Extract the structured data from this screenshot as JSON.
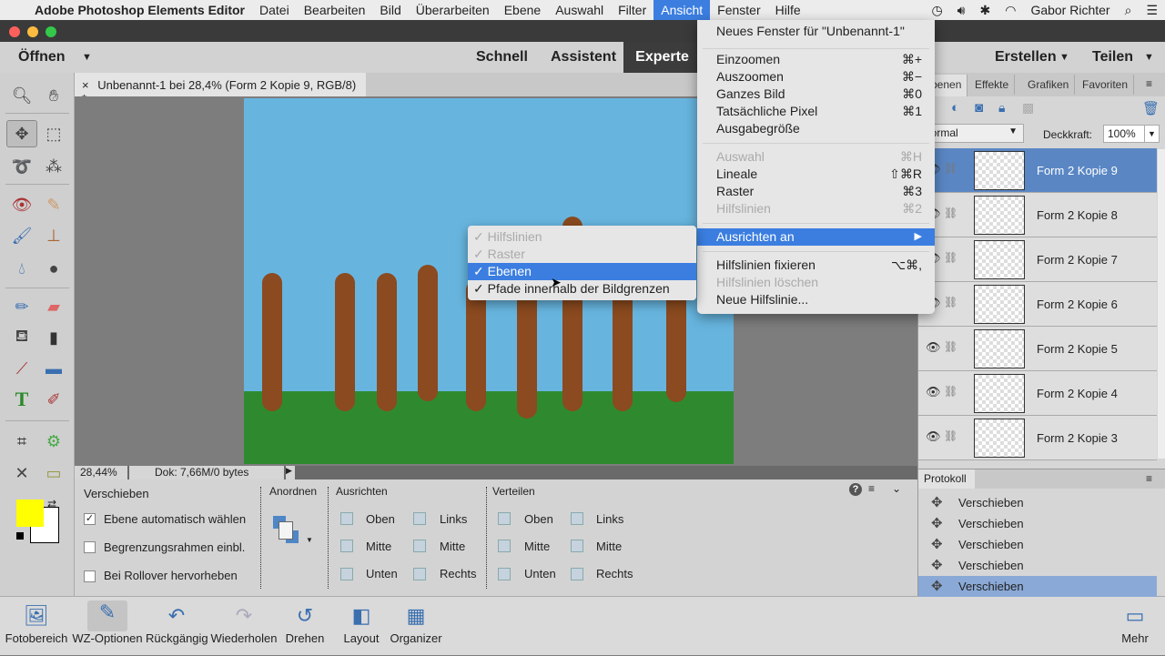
{
  "menubar": {
    "apple": "",
    "app": "Adobe Photoshop Elements Editor",
    "items": [
      "Datei",
      "Bearbeiten",
      "Bild",
      "Überarbeiten",
      "Ebene",
      "Auswahl",
      "Filter",
      "Ansicht",
      "Fenster",
      "Hilfe"
    ],
    "user": "Gabor Richter"
  },
  "topbar": {
    "open": "Öffnen",
    "modes": [
      "Schnell",
      "Assistent",
      "Experte"
    ],
    "create": "Erstellen",
    "share": "Teilen"
  },
  "document": {
    "tab": "Unbenannt-1 bei 28,4% (Form 2 Kopie 9, RGB/8) *",
    "close": "×",
    "zoom": "28,44%",
    "doc": "Dok: 7,66M/0 bytes"
  },
  "colors": {
    "sky": "#67b5df",
    "grass": "#2f8a2f",
    "post": "#8b4a1f",
    "foreground": "#ffff00",
    "background": "#ffffff",
    "accent": "#3b7ee0"
  },
  "view_menu": {
    "items": [
      {
        "label": "Neues Fenster für \"Unbenannt-1\"",
        "shortcut": "",
        "disabled": false
      },
      {
        "label": "Einzoomen",
        "shortcut": "⌘+"
      },
      {
        "label": "Auszoomen",
        "shortcut": "⌘−"
      },
      {
        "label": "Ganzes Bild",
        "shortcut": "⌘0"
      },
      {
        "label": "Tatsächliche Pixel",
        "shortcut": "⌘1"
      },
      {
        "label": "Ausgabegröße",
        "shortcut": ""
      },
      {
        "label": "Auswahl",
        "shortcut": "⌘H"
      },
      {
        "label": "Lineale",
        "shortcut": "⇧⌘R"
      },
      {
        "label": "Raster",
        "shortcut": "⌘3"
      },
      {
        "label": "Hilfslinien",
        "shortcut": "⌘2"
      },
      {
        "label": "Ausrichten an",
        "shortcut": "▶"
      },
      {
        "label": "Hilfslinien fixieren",
        "shortcut": "⌥⌘,"
      },
      {
        "label": "Hilfslinien löschen",
        "shortcut": ""
      },
      {
        "label": "Neue Hilfslinie...",
        "shortcut": ""
      }
    ]
  },
  "snap_submenu": {
    "items": [
      {
        "label": "Hilfslinien",
        "check": "✓"
      },
      {
        "label": "Raster",
        "check": "✓"
      },
      {
        "label": "Ebenen",
        "check": "✓"
      },
      {
        "label": "Pfade innerhalb der Bildgrenzen",
        "check": "✓"
      }
    ]
  },
  "options": {
    "tool": "Verschieben",
    "auto_select": "Ebene automatisch wählen",
    "auto_select_checked": true,
    "bbox": "Begrenzungsrahmen einbl.",
    "bbox_checked": false,
    "rollover": "Bei Rollover hervorheben",
    "rollover_checked": false,
    "arrange": "Anordnen",
    "align": "Ausrichten",
    "distribute": "Verteilen",
    "align_items": [
      "Oben",
      "Mitte",
      "Unten",
      "Links",
      "Mitte",
      "Rechts"
    ],
    "distribute_items": [
      "Oben",
      "Mitte",
      "Unten",
      "Links",
      "Mitte",
      "Rechts"
    ],
    "help": "?"
  },
  "bottombar": {
    "items": [
      "Fotobereich",
      "WZ-Optionen",
      "Rückgängig",
      "Wiederholen",
      "Drehen",
      "Layout",
      "Organizer"
    ],
    "more": "Mehr"
  },
  "layers_panel": {
    "tabs": [
      "Ebenen",
      "Effekte",
      "Grafiken",
      "Favoriten"
    ],
    "blend_mode": "Normal",
    "opacity_label": "Deckkraft:",
    "opacity": "100%",
    "layers": [
      "Form 2 Kopie 9",
      "Form 2 Kopie 8",
      "Form 2 Kopie 7",
      "Form 2 Kopie 6",
      "Form 2 Kopie 5",
      "Form 2 Kopie 4",
      "Form 2 Kopie 3"
    ],
    "selected": 0
  },
  "history_panel": {
    "title": "Protokoll",
    "items": [
      "Verschieben",
      "Verschieben",
      "Verschieben",
      "Verschieben",
      "Verschieben"
    ],
    "selected": 4
  }
}
